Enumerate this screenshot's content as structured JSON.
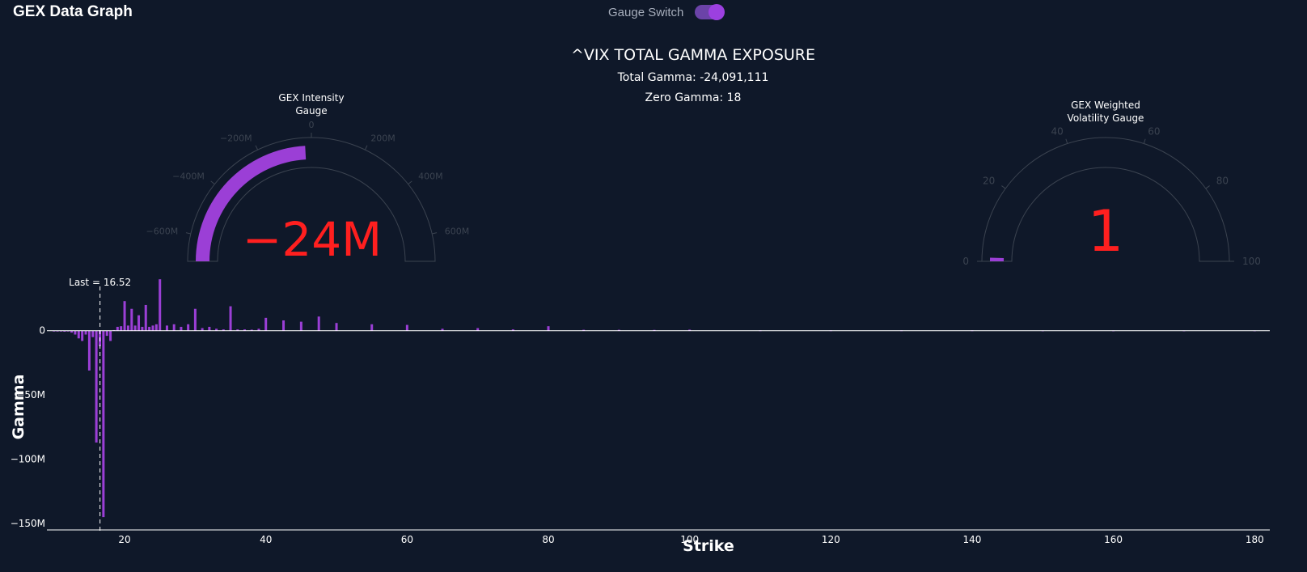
{
  "app": {
    "title": "GEX Data Graph"
  },
  "gauge_switch": {
    "label": "Gauge Switch",
    "on": true
  },
  "colors": {
    "background": "#0f1829",
    "accent": "#9b3fd6",
    "value_text": "#ff1f1f",
    "axis_text": "#ffffff",
    "gauge_tick": "#3b4350"
  },
  "chart_data": [
    {
      "type": "gauge",
      "title": "GEX Intensity Gauge",
      "title_lines": [
        "GEX Intensity",
        "Gauge"
      ],
      "value": -24091111,
      "value_display": "−24M",
      "range": [
        -700000000,
        700000000
      ],
      "ticks": [
        {
          "value": -600000000,
          "label": "−600M"
        },
        {
          "value": -400000000,
          "label": "−400M"
        },
        {
          "value": -200000000,
          "label": "−200M"
        },
        {
          "value": 0,
          "label": "0"
        },
        {
          "value": 200000000,
          "label": "200M"
        },
        {
          "value": 400000000,
          "label": "400M"
        },
        {
          "value": 600000000,
          "label": "600M"
        }
      ]
    },
    {
      "type": "gauge",
      "title": "GEX Weighted Volatility Gauge",
      "title_lines": [
        "GEX Weighted",
        "Volatility Gauge"
      ],
      "value": 1,
      "value_display": "1",
      "range": [
        0,
        100
      ],
      "ticks": [
        {
          "value": 0,
          "label": "0"
        },
        {
          "value": 20,
          "label": "20"
        },
        {
          "value": 40,
          "label": "40"
        },
        {
          "value": 60,
          "label": "60"
        },
        {
          "value": 80,
          "label": "80"
        },
        {
          "value": 100,
          "label": "100"
        }
      ]
    },
    {
      "type": "bar",
      "title": "^VIX TOTAL GAMMA EXPOSURE",
      "subtitle_lines": [
        "Total Gamma: -24,091,111",
        "Zero Gamma: 18"
      ],
      "xlabel": "Strike",
      "ylabel": "Gamma",
      "xlim": [
        9,
        181
      ],
      "ylim": [
        -155000000,
        42000000
      ],
      "xticks": [
        {
          "value": 20,
          "label": "20"
        },
        {
          "value": 40,
          "label": "40"
        },
        {
          "value": 60,
          "label": "60"
        },
        {
          "value": 80,
          "label": "80"
        },
        {
          "value": 100,
          "label": "100"
        },
        {
          "value": 120,
          "label": "120"
        },
        {
          "value": 140,
          "label": "140"
        },
        {
          "value": 160,
          "label": "160"
        },
        {
          "value": 180,
          "label": "180"
        }
      ],
      "yticks": [
        {
          "value": 0,
          "label": "0"
        },
        {
          "value": -50000000,
          "label": "−50M"
        },
        {
          "value": -100000000,
          "label": "−100M"
        },
        {
          "value": -150000000,
          "label": "−150M"
        }
      ],
      "last_price": {
        "value": 16.52,
        "label": "Last = 16.52"
      },
      "x": [
        10,
        10.5,
        11,
        11.5,
        12,
        12.5,
        13,
        13.5,
        14,
        14.5,
        15,
        15.5,
        16,
        16.5,
        17,
        17.5,
        18,
        18.5,
        19,
        19.5,
        20,
        20.5,
        21,
        21.5,
        22,
        22.5,
        23,
        23.5,
        24,
        24.5,
        25,
        26,
        27,
        28,
        29,
        30,
        31,
        32,
        33,
        34,
        35,
        36,
        37,
        38,
        39,
        40,
        42.5,
        45,
        47.5,
        50,
        55,
        60,
        65,
        70,
        75,
        80,
        85,
        90,
        95,
        100,
        110,
        120,
        130,
        140,
        150,
        160,
        170,
        180
      ],
      "values": [
        -300000,
        -500000,
        -400000,
        -800000,
        -600000,
        -1500000,
        -3000000,
        -6000000,
        -8000000,
        -3000000,
        -31000000,
        -5000000,
        -87000000,
        -12000000,
        -145000000,
        -4000000,
        -8000000,
        500000,
        3000000,
        3500000,
        23000000,
        4000000,
        17000000,
        4000000,
        12000000,
        3000000,
        20000000,
        3000000,
        4000000,
        5000000,
        40000000,
        4000000,
        5000000,
        3000000,
        5000000,
        17000000,
        2000000,
        3000000,
        1500000,
        1000000,
        19000000,
        1000000,
        1000000,
        800000,
        1500000,
        10000000,
        8000000,
        7000000,
        11000000,
        6000000,
        5000000,
        4500000,
        1500000,
        2000000,
        1000000,
        3500000,
        700000,
        700000,
        600000,
        800000,
        300000,
        300000,
        300000,
        300000,
        200000,
        200000,
        200000,
        200000
      ]
    }
  ]
}
